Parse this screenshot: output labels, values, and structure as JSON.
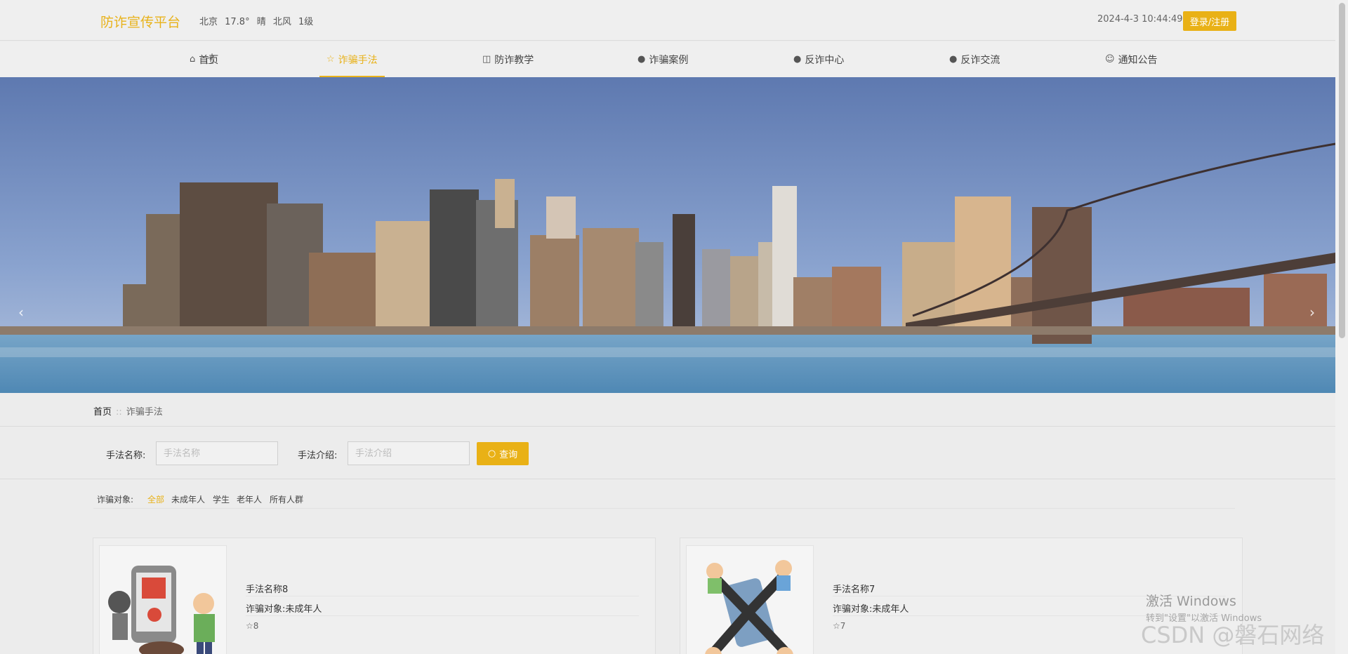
{
  "header": {
    "brand": "防诈宣传平台",
    "weather": "北京 17.8° 晴 北风 1级",
    "datetime": "2024-4-3 10:44:49",
    "login_label": "登录/注册"
  },
  "nav": {
    "items": [
      {
        "label": "首页",
        "icon": "home-icon"
      },
      {
        "label": "诈骗手法",
        "icon": "star-icon",
        "active": true
      },
      {
        "label": "防诈教学",
        "icon": "bag-icon"
      },
      {
        "label": "诈骗案例",
        "icon": "alert-icon"
      },
      {
        "label": "反诈中心",
        "icon": "question-icon"
      },
      {
        "label": "反诈交流",
        "icon": "info-icon"
      },
      {
        "label": "通知公告",
        "icon": "smile-icon"
      }
    ]
  },
  "carousel": {
    "prev": "‹",
    "next": "›",
    "slide_count": 3,
    "active_index": 0
  },
  "breadcrumb": {
    "home": "首页",
    "separator": "::",
    "current": "诈骗手法"
  },
  "search": {
    "name_label": "手法名称:",
    "name_placeholder": "手法名称",
    "intro_label": "手法介绍:",
    "intro_placeholder": "手法介绍",
    "button_label": "查询"
  },
  "filter": {
    "label": "诈骗对象:",
    "options": [
      "全部",
      "未成年人",
      "学生",
      "老年人",
      "所有人群"
    ],
    "active": "全部"
  },
  "cards": [
    {
      "title": "手法名称8",
      "target": "诈骗对象:未成年人",
      "favorites": "8"
    },
    {
      "title": "手法名称7",
      "target": "诈骗对象:未成年人",
      "favorites": "7"
    }
  ],
  "watermark": {
    "line1": "激活 Windows",
    "line2": "转到\"设置\"以激活 Windows",
    "csdn": "CSDN @磐石网络"
  },
  "colors": {
    "accent": "#e9b116",
    "background": "#ececec"
  }
}
